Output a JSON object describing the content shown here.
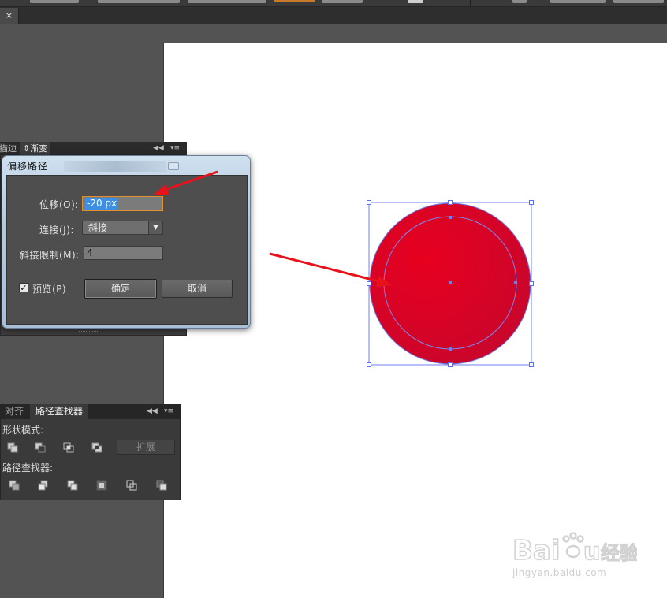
{
  "document": {
    "close_glyph": "×"
  },
  "top_panel": {
    "tabs": [
      "描边",
      "渐变"
    ],
    "collapse_glyph": "◀◀",
    "menu_glyph": "▾≡"
  },
  "dialog": {
    "title": "偏移路径",
    "offset_label": "位移(O):",
    "offset_value": "-20 px",
    "join_label": "连接(J):",
    "join_value": "斜接",
    "miter_label": "斜接限制(M):",
    "miter_value": "4",
    "preview_label": "预览(P)",
    "preview_checked": true,
    "ok_label": "确定",
    "cancel_label": "取消"
  },
  "pathfinder_panel": {
    "tab_align": "对齐",
    "tab_pathfinder": "路径查找器",
    "collapse_glyph": "◀◀",
    "menu_glyph": "▾≡",
    "shape_modes_label": "形状模式:",
    "expand_label": "扩展",
    "pathfinders_label": "路径查找器:"
  },
  "canvas": {
    "circle_color": "#d8001e",
    "selection_color": "#5a6fff",
    "annotation_arrow_color": "#e8121a"
  },
  "watermark": {
    "brand": "Baidu经验",
    "url": "jingyan.baidu.com"
  },
  "icons": [
    "close-icon",
    "collapse-icon",
    "panel-menu-icon",
    "dropdown-arrow-icon",
    "checkbox-check-icon",
    "unite-icon",
    "minus-front-icon",
    "intersect-icon",
    "exclude-icon",
    "divide-icon",
    "trim-icon",
    "merge-icon",
    "crop-icon",
    "outline-icon",
    "minus-back-icon"
  ]
}
